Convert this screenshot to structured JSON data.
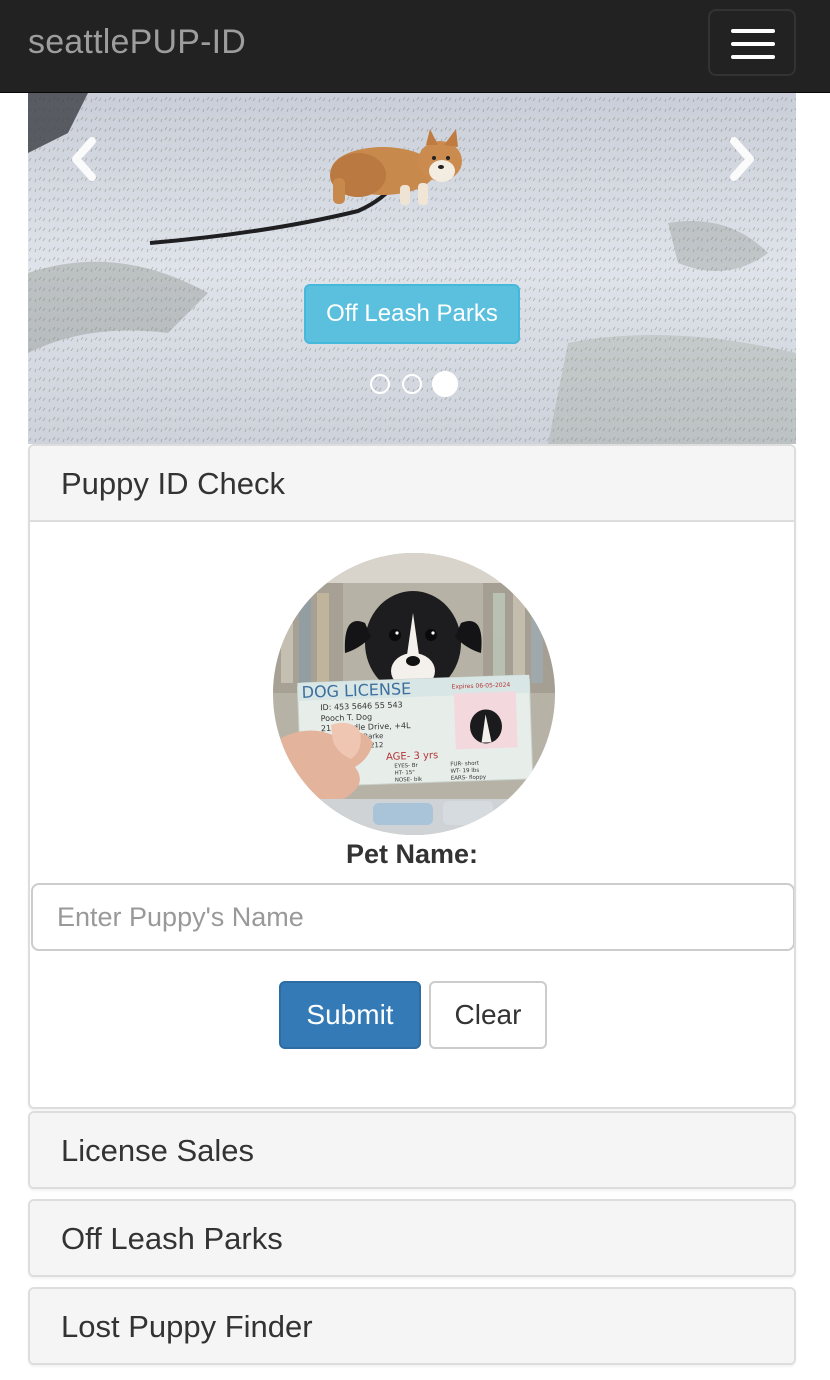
{
  "navbar": {
    "brand": "seattlePUP-ID",
    "menu_icon": "hamburger-icon"
  },
  "carousel": {
    "prev_icon": "chevron-left-icon",
    "next_icon": "chevron-right-icon",
    "caption_button": "Off Leash Parks",
    "slide_count": 3,
    "active_slide": 3
  },
  "panels": [
    {
      "title": "Puppy ID Check",
      "expanded": true,
      "image": "dog-license-puppy-photo",
      "image_text": {
        "header": "DOG LICENSE",
        "expires": "Expires 06-05-2024",
        "id": "ID: 453 5646 55 543",
        "name": "Pooch T. Dog",
        "address": "213 Poodle Drive, +4L",
        "city": "Barke",
        "zip": "1212",
        "age": "AGE- 3 yrs",
        "eyes": "EYES- Br",
        "fur": "FUR- short",
        "height": "HT- 15\"",
        "weight": "WT- 19 lbs",
        "nose": "NOSE- blk",
        "ears": "EARS- floppy"
      },
      "label": "Pet Name:",
      "input_placeholder": "Enter Puppy's Name",
      "input_value": "",
      "submit_label": "Submit",
      "clear_label": "Clear"
    },
    {
      "title": "License Sales",
      "expanded": false
    },
    {
      "title": "Off Leash Parks",
      "expanded": false
    },
    {
      "title": "Lost Puppy Finder",
      "expanded": false
    }
  ],
  "colors": {
    "navbar_bg": "#222222",
    "brand_text": "#9d9d9d",
    "info_button": "#5bc0de",
    "primary_button": "#337ab7",
    "panel_heading_bg": "#f5f5f5"
  }
}
